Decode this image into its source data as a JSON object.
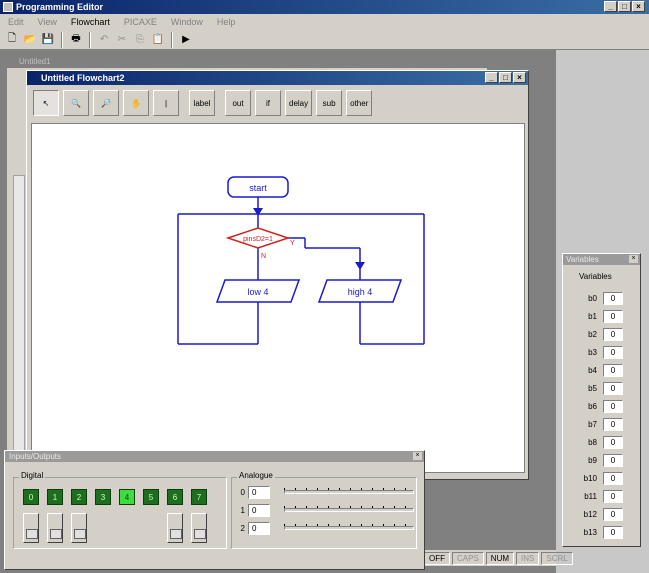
{
  "app": {
    "title": "Programming Editor"
  },
  "menu": {
    "items": [
      "Edit",
      "View",
      "Flowchart",
      "PICAXE",
      "Window",
      "Help"
    ],
    "active_index": 2
  },
  "toolbar": {
    "run_label": "▶"
  },
  "back_window": {
    "title": "Untitled1"
  },
  "flowchart_window": {
    "title": "Untitled Flowchart2",
    "tools": [
      {
        "label": "↖",
        "name": "select-tool-button"
      },
      {
        "label": "🔍",
        "name": "zoom-in-tool-button"
      },
      {
        "label": "🔎",
        "name": "zoom-out-tool-button"
      },
      {
        "label": "✋",
        "name": "pan-tool-button"
      },
      {
        "label": "|",
        "name": "line-tool-button"
      },
      {
        "label": "label",
        "name": "label-tool-button"
      },
      {
        "label": "out",
        "name": "out-command-button"
      },
      {
        "label": "if",
        "name": "if-command-button"
      },
      {
        "label": "delay",
        "name": "delay-command-button"
      },
      {
        "label": "sub",
        "name": "sub-command-button"
      },
      {
        "label": "other",
        "name": "other-command-button"
      }
    ]
  },
  "flowchart": {
    "start_label": "start",
    "decision_label": "pinsD2=1",
    "decision_yes": "Y",
    "decision_no": "N",
    "left_action": "low 4",
    "right_action": "high 4",
    "colors": {
      "flow": "#1a1acc",
      "decision": "#d02020"
    }
  },
  "io_panel": {
    "title": "Inputs/Outputs",
    "digital_label": "Digital",
    "outputs": [
      "0",
      "1",
      "2",
      "3",
      "4",
      "5",
      "6",
      "7"
    ],
    "outputs_on": [
      4
    ],
    "inputs_shown": [
      0,
      1,
      2,
      6,
      7
    ],
    "analogue_label": "Analogue",
    "analogue": [
      {
        "channel": "0",
        "value": "0"
      },
      {
        "channel": "1",
        "value": "0"
      },
      {
        "channel": "2",
        "value": "0"
      }
    ]
  },
  "variables_panel": {
    "title": "Variables",
    "heading": "Variables",
    "vars": [
      {
        "name": "b0",
        "value": "0"
      },
      {
        "name": "b1",
        "value": "0"
      },
      {
        "name": "b2",
        "value": "0"
      },
      {
        "name": "b3",
        "value": "0"
      },
      {
        "name": "b4",
        "value": "0"
      },
      {
        "name": "b5",
        "value": "0"
      },
      {
        "name": "b6",
        "value": "0"
      },
      {
        "name": "b7",
        "value": "0"
      },
      {
        "name": "b8",
        "value": "0"
      },
      {
        "name": "b9",
        "value": "0"
      },
      {
        "name": "b10",
        "value": "0"
      },
      {
        "name": "b11",
        "value": "0"
      },
      {
        "name": "b12",
        "value": "0"
      },
      {
        "name": "b13",
        "value": "0"
      }
    ]
  },
  "status": {
    "items": [
      "OFF",
      "CAPS",
      "NUM",
      "INS",
      "SCRL"
    ],
    "active": [
      0,
      2
    ]
  }
}
